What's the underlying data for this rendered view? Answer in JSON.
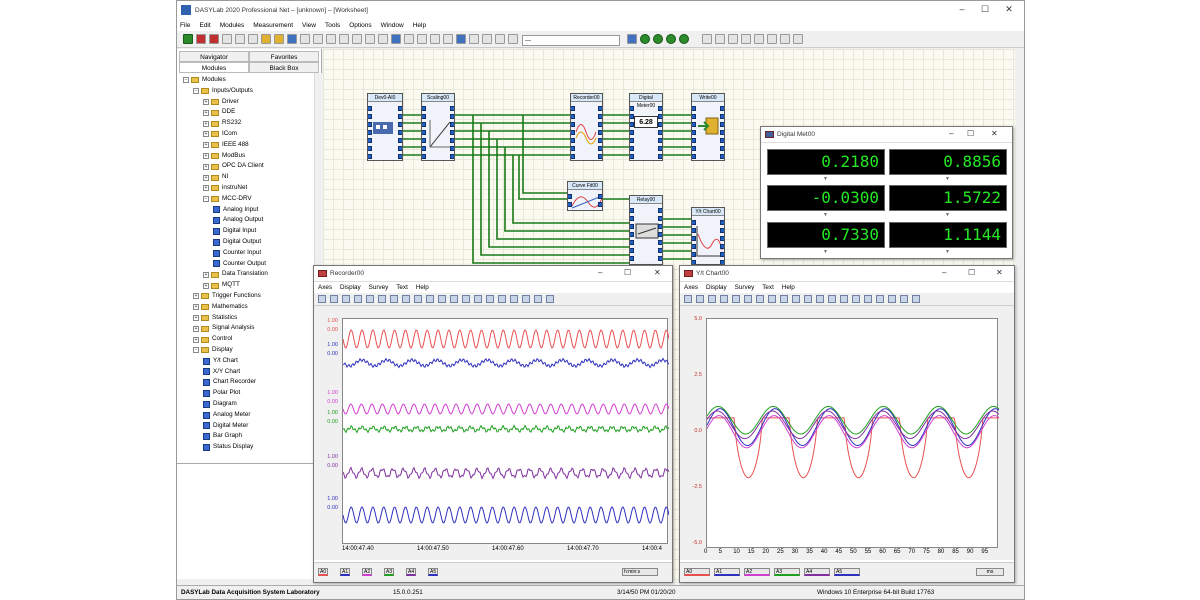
{
  "window": {
    "title": "DASYLab 2020 Professional Net – [unknown] – [Worksheet]"
  },
  "menu": [
    "File",
    "Edit",
    "Modules",
    "Measurement",
    "View",
    "Tools",
    "Options",
    "Window",
    "Help"
  ],
  "navigator": {
    "tabs": [
      "Navigator",
      "Favorites",
      "Modules",
      "Black Box"
    ],
    "tree": [
      {
        "label": "Modules",
        "level": 0,
        "type": "folder",
        "expanded": true
      },
      {
        "label": "Inputs/Outputs",
        "level": 1,
        "type": "folder",
        "expanded": true
      },
      {
        "label": "Driver",
        "level": 2,
        "type": "folder"
      },
      {
        "label": "DDE",
        "level": 2,
        "type": "folder"
      },
      {
        "label": "RS232",
        "level": 2,
        "type": "folder"
      },
      {
        "label": "ICom",
        "level": 2,
        "type": "folder"
      },
      {
        "label": "IEEE 488",
        "level": 2,
        "type": "folder"
      },
      {
        "label": "ModBus",
        "level": 2,
        "type": "folder"
      },
      {
        "label": "OPC DA Client",
        "level": 2,
        "type": "folder"
      },
      {
        "label": "NI",
        "level": 2,
        "type": "folder"
      },
      {
        "label": "instruNet",
        "level": 2,
        "type": "folder"
      },
      {
        "label": "MCC-DRV",
        "level": 2,
        "type": "folder",
        "expanded": true
      },
      {
        "label": "Analog Input",
        "level": 3,
        "type": "module"
      },
      {
        "label": "Analog Output",
        "level": 3,
        "type": "module"
      },
      {
        "label": "Digital Input",
        "level": 3,
        "type": "module"
      },
      {
        "label": "Digital Output",
        "level": 3,
        "type": "module"
      },
      {
        "label": "Counter Input",
        "level": 3,
        "type": "module"
      },
      {
        "label": "Counter Output",
        "level": 3,
        "type": "module"
      },
      {
        "label": "Data Translation",
        "level": 2,
        "type": "folder"
      },
      {
        "label": "MQTT",
        "level": 2,
        "type": "folder"
      },
      {
        "label": "Trigger Functions",
        "level": 1,
        "type": "folder"
      },
      {
        "label": "Mathematics",
        "level": 1,
        "type": "folder"
      },
      {
        "label": "Statistics",
        "level": 1,
        "type": "folder"
      },
      {
        "label": "Signal Analysis",
        "level": 1,
        "type": "folder"
      },
      {
        "label": "Control",
        "level": 1,
        "type": "folder"
      },
      {
        "label": "Display",
        "level": 1,
        "type": "folder",
        "expanded": true
      },
      {
        "label": "Y/t Chart",
        "level": 2,
        "type": "module"
      },
      {
        "label": "X/Y Chart",
        "level": 2,
        "type": "module"
      },
      {
        "label": "Chart Recorder",
        "level": 2,
        "type": "module"
      },
      {
        "label": "Polar Plot",
        "level": 2,
        "type": "module"
      },
      {
        "label": "Diagram",
        "level": 2,
        "type": "module"
      },
      {
        "label": "Analog Meter",
        "level": 2,
        "type": "module"
      },
      {
        "label": "Digital Meter",
        "level": 2,
        "type": "module"
      },
      {
        "label": "Bar Graph",
        "level": 2,
        "type": "module"
      },
      {
        "label": "Status Display",
        "level": 2,
        "type": "module"
      }
    ]
  },
  "worksheet": {
    "modules": [
      "Dev0-AI0",
      "Scaling00",
      "Recorder00",
      "Digital Meter00",
      "Write00",
      "Curve Fit00",
      "Relay00",
      "Y/t Chart00"
    ],
    "meter_display": "6.28"
  },
  "digital_meter": {
    "title": "Digital Met00",
    "values": [
      "0.2180",
      "0.8856",
      "-0.0300",
      "1.5722",
      "0.7330",
      "1.1144"
    ]
  },
  "recorder": {
    "title": "Recorder00",
    "menu": [
      "Axes",
      "Display",
      "Survey",
      "Text",
      "Help"
    ],
    "y_labels": [
      "1.00",
      "0.00",
      "1.00",
      "0.00",
      "1.00",
      "0.00",
      "1.00",
      "0.00",
      "1.00",
      "0.00",
      "1.00",
      "0.00"
    ],
    "x_labels": [
      "14:00:47.40",
      "14:00:47.50",
      "14:00:47.60",
      "14:00:47.70",
      "14:00:4"
    ],
    "channels": [
      "A0",
      "A1",
      "A2",
      "A3",
      "A4",
      "A5"
    ],
    "time_unit": "h:min:s"
  },
  "ytchart": {
    "title": "Y/t Chart00",
    "menu": [
      "Axes",
      "Display",
      "Survey",
      "Text",
      "Help"
    ],
    "y_labels": [
      "5.0",
      "2.5",
      "0.0",
      "-2.5",
      "-5.0"
    ],
    "x_labels": [
      "0",
      "5",
      "10",
      "15",
      "20",
      "25",
      "30",
      "35",
      "40",
      "45",
      "50",
      "55",
      "60",
      "65",
      "70",
      "75",
      "80",
      "85",
      "90",
      "95"
    ],
    "channels": [
      "A0",
      "A1",
      "A2",
      "A3",
      "A4",
      "A5"
    ],
    "time_unit": "ms"
  },
  "statusbar": {
    "app": "DASYLab Data Acquisition System Laboratory",
    "version": "15.0.0.251",
    "datetime": "3/14/50 PM 01/20/20",
    "os": "Windows 10 Enterprise 64-bit Build 17763"
  },
  "colors": {
    "red": "#e85050",
    "blue": "#3030c0",
    "magenta": "#d040d0",
    "green": "#20a020",
    "purple": "#8030a0",
    "wire": "#1a7a1a"
  }
}
